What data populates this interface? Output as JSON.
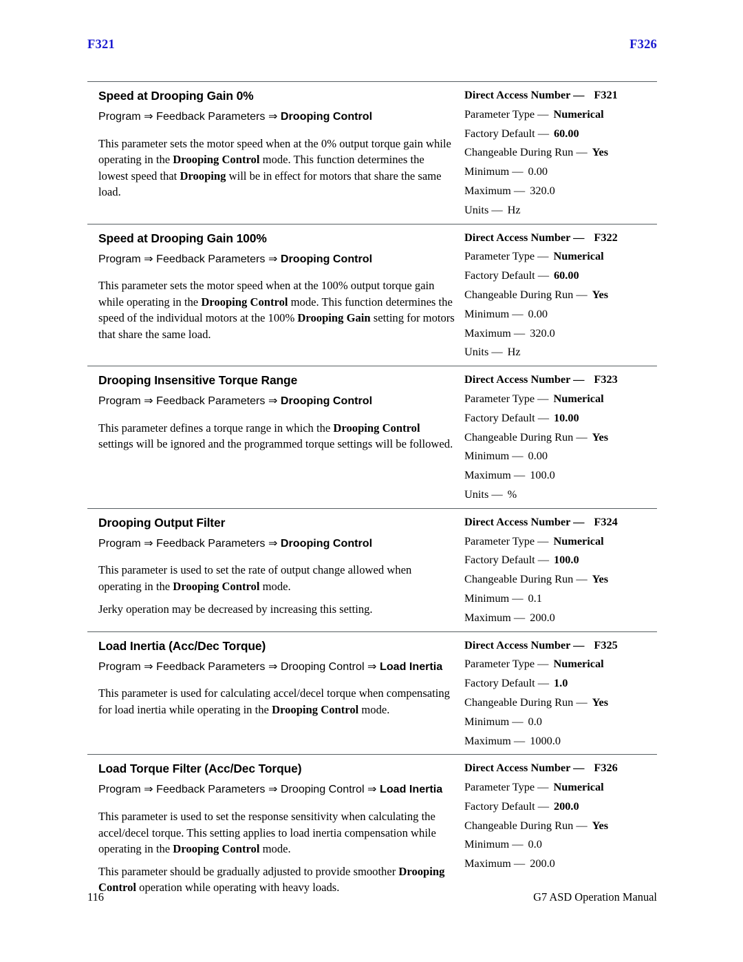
{
  "header": {
    "left": "F321",
    "right": "F326",
    "color": "#1b1bd0"
  },
  "footer": {
    "page_number": "116",
    "manual_title": "G7 ASD Operation Manual"
  },
  "labels": {
    "direct_access_number": "Direct Access Number —",
    "parameter_type": "Parameter Type —",
    "factory_default": "Factory Default —",
    "changeable_during_run": "Changeable During Run —",
    "minimum": "Minimum —",
    "maximum": "Maximum —",
    "units": "Units —"
  },
  "blocks": [
    {
      "title": "Speed at Drooping Gain 0%",
      "path": {
        "plain_prefix": "Program ⇒ Feedback Parameters ⇒ ",
        "bold_suffix": "Drooping Control"
      },
      "paragraphs": [
        [
          {
            "t": "This parameter sets the motor speed when at the 0% output torque gain while operating in the ",
            "b": false
          },
          {
            "t": "Drooping Control",
            "b": true
          },
          {
            "t": " mode. This function determines the lowest speed that ",
            "b": false
          },
          {
            "t": "Drooping",
            "b": true
          },
          {
            "t": " will be in effect for motors that share the same load.",
            "b": false
          }
        ]
      ],
      "spec": {
        "direct_access_number": "F321",
        "parameter_type": "Numerical",
        "factory_default": "60.00",
        "changeable_during_run": "Yes",
        "minimum": "0.00",
        "maximum": "320.0",
        "units": "Hz"
      }
    },
    {
      "title": "Speed at Drooping Gain 100%",
      "path": {
        "plain_prefix": "Program ⇒ Feedback Parameters ⇒ ",
        "bold_suffix": "Drooping Control"
      },
      "paragraphs": [
        [
          {
            "t": "This parameter sets the motor speed when at the 100% output torque gain while operating in the ",
            "b": false
          },
          {
            "t": "Drooping Control",
            "b": true
          },
          {
            "t": " mode. This function determines the speed of the individual motors at the 100% ",
            "b": false
          },
          {
            "t": "Drooping Gain",
            "b": true
          },
          {
            "t": " setting for motors that share the same load.",
            "b": false
          }
        ]
      ],
      "spec": {
        "direct_access_number": "F322",
        "parameter_type": "Numerical",
        "factory_default": "60.00",
        "changeable_during_run": "Yes",
        "minimum": "0.00",
        "maximum": "320.0",
        "units": "Hz"
      }
    },
    {
      "title": "Drooping Insensitive Torque Range",
      "path": {
        "plain_prefix": "Program ⇒ Feedback Parameters ⇒ ",
        "bold_suffix": "Drooping Control"
      },
      "paragraphs": [
        [
          {
            "t": "This parameter defines a torque range in which the ",
            "b": false
          },
          {
            "t": "Drooping Control",
            "b": true
          },
          {
            "t": " settings will be ignored and the programmed torque settings will be followed.",
            "b": false
          }
        ]
      ],
      "spec": {
        "direct_access_number": "F323",
        "parameter_type": "Numerical",
        "factory_default": "10.00",
        "changeable_during_run": "Yes",
        "minimum": "0.00",
        "maximum": "100.0",
        "units": "%"
      }
    },
    {
      "title": "Drooping Output Filter",
      "path": {
        "plain_prefix": "Program ⇒ Feedback Parameters ⇒ ",
        "bold_suffix": "Drooping Control"
      },
      "paragraphs": [
        [
          {
            "t": "This parameter is used to set the rate of output change allowed when operating in the ",
            "b": false
          },
          {
            "t": "Drooping Control",
            "b": true
          },
          {
            "t": " mode.",
            "b": false
          }
        ],
        [
          {
            "t": "Jerky operation may be decreased by increasing this setting.",
            "b": false
          }
        ]
      ],
      "spec": {
        "direct_access_number": "F324",
        "parameter_type": "Numerical",
        "factory_default": "100.0",
        "changeable_during_run": "Yes",
        "minimum": "0.1",
        "maximum": "200.0",
        "units": null
      }
    },
    {
      "title": "Load Inertia (Acc/Dec Torque)",
      "path": {
        "plain_prefix": "Program ⇒ Feedback Parameters ⇒ Drooping Control ⇒ ",
        "bold_suffix": "Load Inertia"
      },
      "paragraphs": [
        [
          {
            "t": "This parameter is used for calculating accel/decel torque when compensating for load inertia while operating in the ",
            "b": false
          },
          {
            "t": "Drooping Control",
            "b": true
          },
          {
            "t": " mode.",
            "b": false
          }
        ]
      ],
      "spec": {
        "direct_access_number": "F325",
        "parameter_type": "Numerical",
        "factory_default": "1.0",
        "changeable_during_run": "Yes",
        "minimum": "0.0",
        "maximum": "1000.0",
        "units": null
      }
    },
    {
      "title": "Load Torque Filter (Acc/Dec Torque)",
      "path": {
        "plain_prefix": "Program ⇒ Feedback Parameters ⇒ Drooping Control ⇒ ",
        "bold_suffix": "Load Inertia"
      },
      "paragraphs": [
        [
          {
            "t": "This parameter is used to set the response sensitivity when calculating the accel/decel torque. This setting applies to load inertia compensation while operating in the ",
            "b": false
          },
          {
            "t": "Drooping Control",
            "b": true
          },
          {
            "t": " mode.",
            "b": false
          }
        ],
        [
          {
            "t": "This parameter should be gradually adjusted to provide smoother ",
            "b": false
          },
          {
            "t": "Drooping Control",
            "b": true
          },
          {
            "t": " operation while operating with heavy loads.",
            "b": false
          }
        ]
      ],
      "spec": {
        "direct_access_number": "F326",
        "parameter_type": "Numerical",
        "factory_default": "200.0",
        "changeable_during_run": "Yes",
        "minimum": "0.0",
        "maximum": "200.0",
        "units": null
      }
    }
  ]
}
